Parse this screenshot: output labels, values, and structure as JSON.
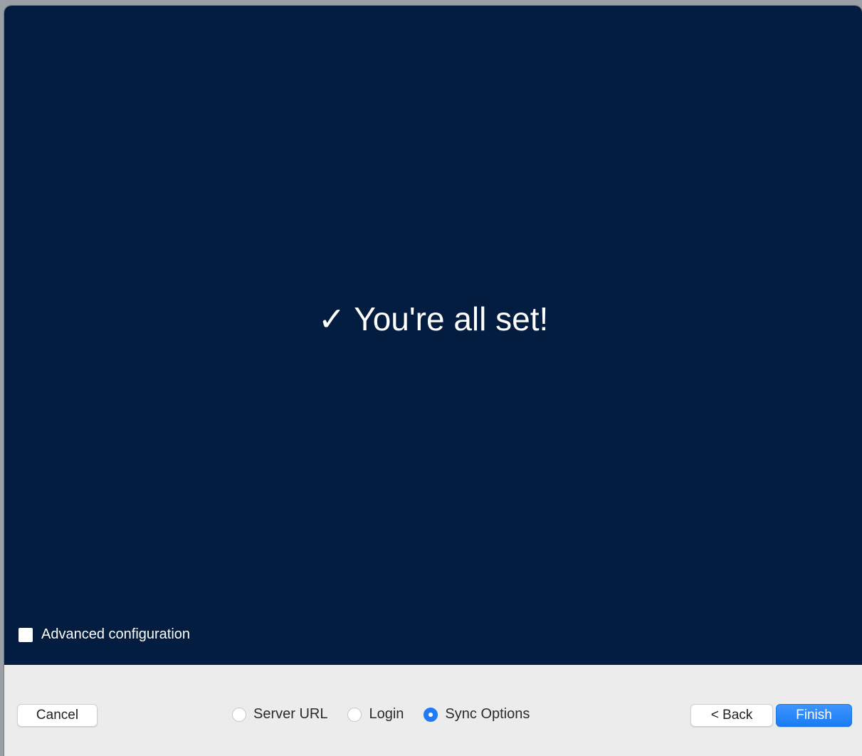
{
  "main": {
    "check_glyph": "✓",
    "headline": "You're all set!",
    "advanced_label": "Advanced configuration",
    "advanced_checked": false
  },
  "footer": {
    "cancel_label": "Cancel",
    "steps": [
      {
        "label": "Server URL",
        "selected": false
      },
      {
        "label": "Login",
        "selected": false
      },
      {
        "label": "Sync Options",
        "selected": true
      }
    ],
    "back_label": "< Back",
    "finish_label": "Finish"
  },
  "colors": {
    "content_background": "#031d40",
    "footer_background": "#ececec",
    "accent": "#1f7cf6"
  }
}
